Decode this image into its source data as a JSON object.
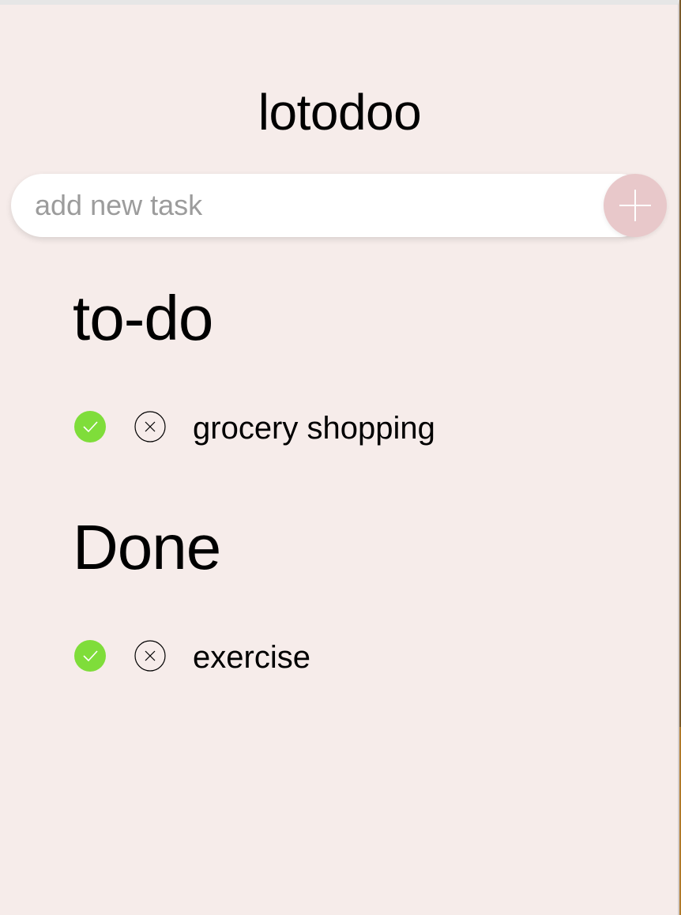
{
  "app": {
    "title": "lotodoo"
  },
  "new_task": {
    "placeholder": "add new task",
    "value": "",
    "add_button_icon": "plus-icon"
  },
  "todo": {
    "heading": "to-do",
    "items": [
      {
        "label": "grocery shopping",
        "complete_icon": "check-icon",
        "delete_icon": "close-circle-icon"
      }
    ]
  },
  "done": {
    "heading": "Done",
    "items": [
      {
        "label": "exercise",
        "complete_icon": "check-icon",
        "delete_icon": "close-circle-icon"
      }
    ]
  },
  "colors": {
    "background": "#f6ecea",
    "accent_add_button": "#e8c8ca",
    "check_green": "#7fdd3a",
    "text": "#000000"
  }
}
